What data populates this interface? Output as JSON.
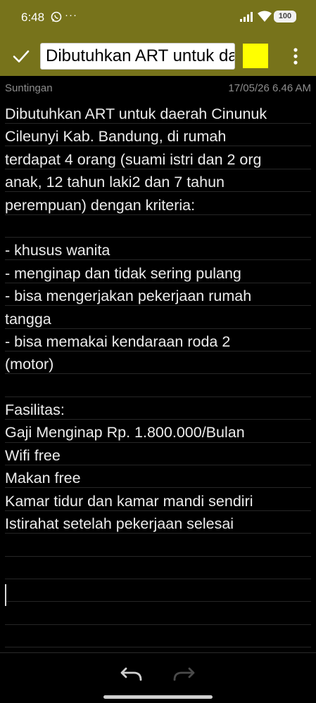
{
  "status_bar": {
    "time": "6:48",
    "dots": "···",
    "battery": "100"
  },
  "toolbar": {
    "title": "Dibutuhkan ART untuk daerah Cinunuk Cileunyi Kab. Bandung"
  },
  "meta": {
    "label": "Suntingan",
    "datetime": "17/05/26 6.46 AM"
  },
  "note": {
    "lines": [
      "Dibutuhkan ART untuk daerah Cinunuk",
      "Cileunyi Kab. Bandung, di rumah",
      "terdapat 4 orang (suami istri dan 2 org",
      "anak, 12 tahun laki2 dan 7 tahun",
      "perempuan) dengan kriteria:",
      "",
      "- khusus wanita",
      "- menginap dan tidak sering pulang",
      "- bisa mengerjakan pekerjaan rumah",
      "tangga",
      "- bisa memakai kendaraan roda 2",
      "(motor)",
      "",
      "Fasilitas:",
      "Gaji Menginap Rp. 1.800.000/Bulan",
      "Wifi free",
      "Makan free",
      "Kamar tidur dan kamar mandi sendiri",
      "Istirahat setelah pekerjaan selesai"
    ]
  },
  "colors": {
    "toolbar": "#77731b",
    "note_color": "#ffff00",
    "background": "#000000",
    "text": "#ececec"
  },
  "icons": [
    "whatsapp-icon",
    "signal-icon",
    "wifi-icon",
    "check-icon",
    "more-vertical-icon",
    "undo-icon",
    "redo-icon"
  ]
}
